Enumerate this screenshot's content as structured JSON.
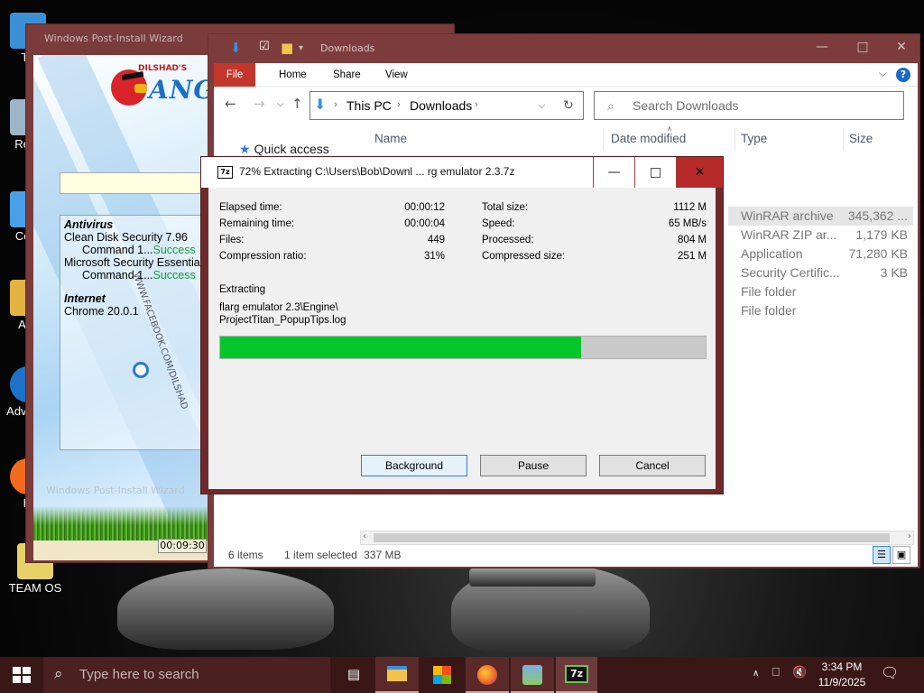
{
  "desktop": {
    "icons": [
      {
        "label": "Th"
      },
      {
        "label": "Recy"
      },
      {
        "label": "Co F"
      },
      {
        "label": "Acti"
      },
      {
        "label": "Adv Sys"
      },
      {
        "label": "Fi"
      },
      {
        "label": "TEAM OS"
      }
    ]
  },
  "wizard": {
    "title": "Windows Post-Install Wizard",
    "logo_small": "DILSHAD'S",
    "logo_text": "ANGRY",
    "watermark": "WWW.FACEBOOK.COM/DILSHAD",
    "list": [
      {
        "text": "Antivirus",
        "kind": "heading"
      },
      {
        "text": "Clean Disk Security 7.96",
        "kind": "item"
      },
      {
        "text": "Command 1...",
        "status": "Success",
        "kind": "sub"
      },
      {
        "text": "Microsoft Security Essentials",
        "kind": "item"
      },
      {
        "text": "Command 1...",
        "status": "Success",
        "kind": "sub"
      },
      {
        "text": "",
        "kind": "gap"
      },
      {
        "text": "Internet",
        "kind": "heading"
      },
      {
        "text": "Chrome 20.0.1",
        "kind": "item"
      }
    ],
    "footer_label": "Windows Post-Install Wizard",
    "timer": "00:09:30"
  },
  "explorer": {
    "title": "Downloads",
    "tabs": [
      "File",
      "Home",
      "Share",
      "View"
    ],
    "address": [
      "This PC",
      "Downloads"
    ],
    "search_placeholder": "Search Downloads",
    "columns": [
      "Name",
      "Date modified",
      "Type",
      "Size"
    ],
    "nav_quick_access": "Quick access",
    "rows": [
      {
        "type": "WinRAR archive",
        "size": "345,362 ...",
        "selected": true
      },
      {
        "type": "WinRAR ZIP ar...",
        "size": "1,179 KB",
        "selected": false
      },
      {
        "type": "Application",
        "size": "71,280 KB",
        "selected": false
      },
      {
        "type": "Security Certific...",
        "size": "3 KB",
        "selected": false
      },
      {
        "type": "File folder",
        "size": "",
        "selected": false
      },
      {
        "type": "File folder",
        "size": "",
        "selected": false
      }
    ],
    "status": {
      "items": "6 items",
      "selected": "1 item selected",
      "size": "337 MB"
    }
  },
  "sevenzip": {
    "title": "72% Extracting C:\\Users\\Bob\\Downl ... rg emulator 2.3.7z",
    "left_stats": [
      {
        "label": "Elapsed time:",
        "value": "00:00:12"
      },
      {
        "label": "Remaining time:",
        "value": "00:00:04"
      },
      {
        "label": "Files:",
        "value": "449"
      },
      {
        "label": "Compression ratio:",
        "value": "31%"
      }
    ],
    "right_stats": [
      {
        "label": "Total size:",
        "value": "1112 M"
      },
      {
        "label": "Speed:",
        "value": "65 MB/s"
      },
      {
        "label": "Processed:",
        "value": "804 M"
      },
      {
        "label": "Compressed size:",
        "value": "251 M"
      }
    ],
    "status_label": "Extracting",
    "current_file_line1": "flarg emulator 2.3\\Engine\\",
    "current_file_line2": "ProjectTitan_PopupTips.log",
    "progress_fraction": 0.743,
    "buttons": {
      "background": "Background",
      "pause": "Pause",
      "cancel": "Cancel"
    },
    "colors": {
      "progress": "#06c62b"
    }
  },
  "taskbar": {
    "search_placeholder": "Type here to search",
    "apps": [
      "task-view",
      "file-explorer",
      "microsoft-store",
      "firefox",
      "winrar",
      "7zip"
    ],
    "time": "3:34 PM",
    "date": "11/9/2025"
  }
}
